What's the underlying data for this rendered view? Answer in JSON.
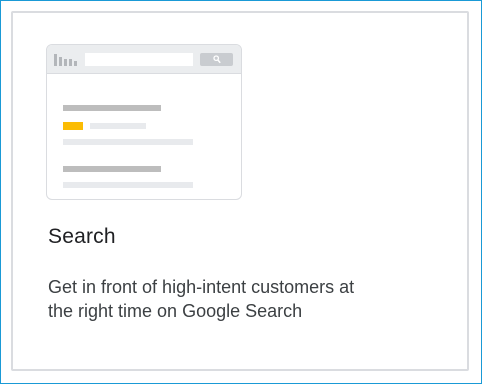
{
  "card": {
    "title": "Search",
    "description": "Get in front of high-intent customers at the right time on Google Search"
  },
  "colors": {
    "frame_border": "#1a9ad6",
    "card_border": "#dadce0",
    "highlight": "#fbbc04",
    "title_text": "#202124",
    "body_text": "#3c4043"
  },
  "icons": {
    "logo": "bars-logo-icon",
    "search": "magnifier-search-icon"
  }
}
